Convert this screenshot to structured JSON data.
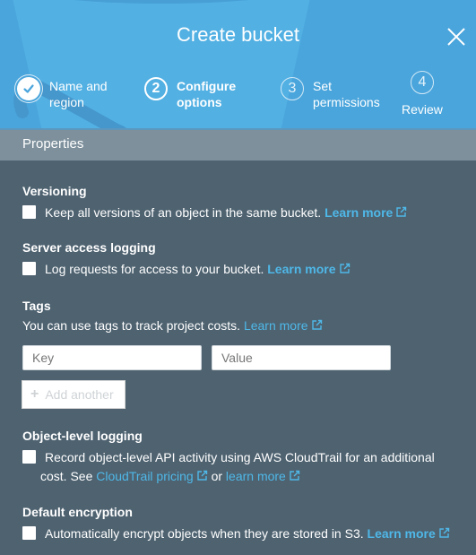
{
  "dialog": {
    "title": "Create bucket",
    "close_icon": "close-icon"
  },
  "steps": [
    {
      "number": "1",
      "label_line1": "Name and",
      "label_line2": "region",
      "state": "completed",
      "icon": "check-circle-icon"
    },
    {
      "number": "2",
      "label_line1": "Configure",
      "label_line2": "options",
      "state": "active"
    },
    {
      "number": "3",
      "label_line1": "Set",
      "label_line2": "permissions",
      "state": "inactive"
    },
    {
      "number": "4",
      "label_line1": "Review",
      "label_line2": "",
      "state": "inactive"
    }
  ],
  "properties": {
    "header": "Properties",
    "versioning": {
      "title": "Versioning",
      "text": "Keep all versions of an object in the same bucket.",
      "link": "Learn more",
      "checked": false
    },
    "server_logging": {
      "title": "Server access logging",
      "text": "Log requests for access to your bucket.",
      "link": "Learn more",
      "checked": false
    },
    "tags": {
      "title": "Tags",
      "description": "You can use tags to track project costs.",
      "link": "Learn more",
      "key_placeholder": "Key",
      "value_placeholder": "Value",
      "add_button": "Add another"
    },
    "object_logging": {
      "title": "Object-level logging",
      "text_line1": "Record object-level API activity using AWS CloudTrail for an additional",
      "text_line2_prefix": "cost. See",
      "link1": "CloudTrail pricing",
      "connector": "or",
      "link2": "learn more",
      "checked": false
    },
    "default_encryption": {
      "title": "Default encryption",
      "text": "Automatically encrypt objects when they are stored in S3.",
      "link": "Learn more",
      "checked": false
    }
  },
  "colors": {
    "header_bg": "#4aa5dc",
    "panel_bg": "#4e6270",
    "properties_header_bg": "#7d909c",
    "link": "#4fb8e8"
  }
}
